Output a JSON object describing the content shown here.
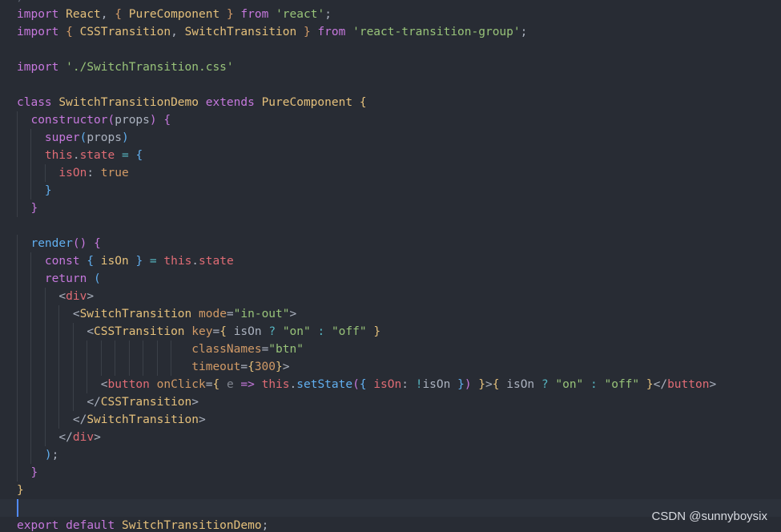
{
  "top_partial": "/",
  "code": {
    "lines": [
      [
        [
          "kw",
          "import"
        ],
        [
          "pl",
          " "
        ],
        [
          "id",
          "React"
        ],
        [
          "pl",
          ", "
        ],
        [
          "br",
          "{"
        ],
        [
          "pl",
          " "
        ],
        [
          "id",
          "PureComponent"
        ],
        [
          "pl",
          " "
        ],
        [
          "br",
          "}"
        ],
        [
          "pl",
          " "
        ],
        [
          "kw",
          "from"
        ],
        [
          "pl",
          " "
        ],
        [
          "str",
          "'react'"
        ],
        [
          "pl",
          ";"
        ]
      ],
      [
        [
          "kw",
          "import"
        ],
        [
          "pl",
          " "
        ],
        [
          "br",
          "{"
        ],
        [
          "pl",
          " "
        ],
        [
          "id",
          "CSSTransition"
        ],
        [
          "pl",
          ", "
        ],
        [
          "id",
          "SwitchTransition"
        ],
        [
          "pl",
          " "
        ],
        [
          "br",
          "}"
        ],
        [
          "pl",
          " "
        ],
        [
          "kw",
          "from"
        ],
        [
          "pl",
          " "
        ],
        [
          "str",
          "'react-transition-group'"
        ],
        [
          "pl",
          ";"
        ]
      ],
      [],
      [
        [
          "kw",
          "import"
        ],
        [
          "pl",
          " "
        ],
        [
          "str",
          "'./SwitchTransition.css'"
        ]
      ],
      [],
      [
        [
          "kw",
          "class"
        ],
        [
          "pl",
          " "
        ],
        [
          "id",
          "SwitchTransitionDemo"
        ],
        [
          "pl",
          " "
        ],
        [
          "kw",
          "extends"
        ],
        [
          "pl",
          " "
        ],
        [
          "id",
          "PureComponent"
        ],
        [
          "pl",
          " "
        ],
        [
          "yb",
          "{"
        ]
      ],
      [
        [
          "pl",
          "  "
        ],
        [
          "pu",
          "constructor"
        ],
        [
          "pu",
          "("
        ],
        [
          "var",
          "props"
        ],
        [
          "pu",
          ")"
        ],
        [
          "pl",
          " "
        ],
        [
          "pu",
          "{"
        ]
      ],
      [
        [
          "pl",
          "    "
        ],
        [
          "kw",
          "super"
        ],
        [
          "bl",
          "("
        ],
        [
          "var",
          "props"
        ],
        [
          "bl",
          ")"
        ]
      ],
      [
        [
          "pl",
          "    "
        ],
        [
          "prop",
          "this"
        ],
        [
          "pl",
          "."
        ],
        [
          "prop",
          "state"
        ],
        [
          "pl",
          " "
        ],
        [
          "op",
          "="
        ],
        [
          "pl",
          " "
        ],
        [
          "bl",
          "{"
        ]
      ],
      [
        [
          "pl",
          "      "
        ],
        [
          "prop",
          "isOn"
        ],
        [
          "pl",
          ": "
        ],
        [
          "at",
          "true"
        ]
      ],
      [
        [
          "pl",
          "    "
        ],
        [
          "bl",
          "}"
        ]
      ],
      [
        [
          "pl",
          "  "
        ],
        [
          "pu",
          "}"
        ]
      ],
      [],
      [
        [
          "pl",
          "  "
        ],
        [
          "fn",
          "render"
        ],
        [
          "pu",
          "()"
        ],
        [
          "pl",
          " "
        ],
        [
          "pu",
          "{"
        ]
      ],
      [
        [
          "pl",
          "    "
        ],
        [
          "kw",
          "const"
        ],
        [
          "pl",
          " "
        ],
        [
          "bl",
          "{"
        ],
        [
          "pl",
          " "
        ],
        [
          "id",
          "isOn"
        ],
        [
          "pl",
          " "
        ],
        [
          "bl",
          "}"
        ],
        [
          "pl",
          " "
        ],
        [
          "op",
          "="
        ],
        [
          "pl",
          " "
        ],
        [
          "prop",
          "this"
        ],
        [
          "pl",
          "."
        ],
        [
          "prop",
          "state"
        ]
      ],
      [
        [
          "pl",
          "    "
        ],
        [
          "kw",
          "return"
        ],
        [
          "pl",
          " "
        ],
        [
          "bl",
          "("
        ]
      ],
      [
        [
          "pl",
          "      "
        ],
        [
          "pl",
          "<"
        ],
        [
          "tg",
          "div"
        ],
        [
          "pl",
          ">"
        ]
      ],
      [
        [
          "pl",
          "        "
        ],
        [
          "pl",
          "<"
        ],
        [
          "id",
          "SwitchTransition"
        ],
        [
          "pl",
          " "
        ],
        [
          "at",
          "mode"
        ],
        [
          "pl",
          "="
        ],
        [
          "str",
          "\"in-out\""
        ],
        [
          "pl",
          ">"
        ]
      ],
      [
        [
          "pl",
          "          "
        ],
        [
          "pl",
          "<"
        ],
        [
          "id",
          "CSSTransition"
        ],
        [
          "pl",
          " "
        ],
        [
          "at",
          "key"
        ],
        [
          "pl",
          "="
        ],
        [
          "yb",
          "{"
        ],
        [
          "pl",
          " "
        ],
        [
          "var",
          "isOn"
        ],
        [
          "pl",
          " "
        ],
        [
          "op",
          "?"
        ],
        [
          "pl",
          " "
        ],
        [
          "str",
          "\"on\""
        ],
        [
          "pl",
          " "
        ],
        [
          "op",
          ":"
        ],
        [
          "pl",
          " "
        ],
        [
          "str",
          "\"off\""
        ],
        [
          "pl",
          " "
        ],
        [
          "yb",
          "}"
        ]
      ],
      [
        [
          "pl",
          "                         "
        ],
        [
          "at",
          "classNames"
        ],
        [
          "pl",
          "="
        ],
        [
          "str",
          "\"btn\""
        ]
      ],
      [
        [
          "pl",
          "                         "
        ],
        [
          "at",
          "timeout"
        ],
        [
          "pl",
          "="
        ],
        [
          "yb",
          "{"
        ],
        [
          "num",
          "300"
        ],
        [
          "yb",
          "}"
        ],
        [
          "pl",
          ">"
        ]
      ],
      [
        [
          "pl",
          "            "
        ],
        [
          "pl",
          "<"
        ],
        [
          "tg",
          "button"
        ],
        [
          "pl",
          " "
        ],
        [
          "at",
          "onClick"
        ],
        [
          "pl",
          "="
        ],
        [
          "yb",
          "{"
        ],
        [
          "pl",
          " "
        ],
        [
          "dim",
          "e"
        ],
        [
          "pl",
          " "
        ],
        [
          "kw",
          "=>"
        ],
        [
          "pl",
          " "
        ],
        [
          "prop",
          "this"
        ],
        [
          "pl",
          "."
        ],
        [
          "fn",
          "setState"
        ],
        [
          "pu",
          "("
        ],
        [
          "bl",
          "{"
        ],
        [
          "pl",
          " "
        ],
        [
          "prop",
          "isOn"
        ],
        [
          "pl",
          ": "
        ],
        [
          "op",
          "!"
        ],
        [
          "var",
          "isOn"
        ],
        [
          "pl",
          " "
        ],
        [
          "bl",
          "}"
        ],
        [
          "pu",
          ")"
        ],
        [
          "pl",
          " "
        ],
        [
          "yb",
          "}"
        ],
        [
          "pl",
          ">"
        ],
        [
          "yb",
          "{"
        ],
        [
          "pl",
          " "
        ],
        [
          "var",
          "isOn"
        ],
        [
          "pl",
          " "
        ],
        [
          "op",
          "?"
        ],
        [
          "pl",
          " "
        ],
        [
          "str",
          "\"on\""
        ],
        [
          "pl",
          " "
        ],
        [
          "op",
          ":"
        ],
        [
          "pl",
          " "
        ],
        [
          "str",
          "\"off\""
        ],
        [
          "pl",
          " "
        ],
        [
          "yb",
          "}"
        ],
        [
          "pl",
          "</"
        ],
        [
          "tg",
          "button"
        ],
        [
          "pl",
          ">"
        ]
      ],
      [
        [
          "pl",
          "          "
        ],
        [
          "pl",
          "</"
        ],
        [
          "id",
          "CSSTransition"
        ],
        [
          "pl",
          ">"
        ]
      ],
      [
        [
          "pl",
          "        "
        ],
        [
          "pl",
          "</"
        ],
        [
          "id",
          "SwitchTransition"
        ],
        [
          "pl",
          ">"
        ]
      ],
      [
        [
          "pl",
          "      "
        ],
        [
          "pl",
          "</"
        ],
        [
          "tg",
          "div"
        ],
        [
          "pl",
          ">"
        ]
      ],
      [
        [
          "pl",
          "    "
        ],
        [
          "bl",
          ")"
        ],
        [
          "pl",
          ";"
        ]
      ],
      [
        [
          "pl",
          "  "
        ],
        [
          "pu",
          "}"
        ]
      ],
      [
        [
          "yb",
          "}"
        ]
      ],
      [],
      [
        [
          "kw",
          "export"
        ],
        [
          "pl",
          " "
        ],
        [
          "kw",
          "default"
        ],
        [
          "pl",
          " "
        ],
        [
          "id",
          "SwitchTransitionDemo"
        ],
        [
          "pl",
          ";"
        ]
      ]
    ]
  },
  "watermark": "CSDN @sunnyboysix"
}
